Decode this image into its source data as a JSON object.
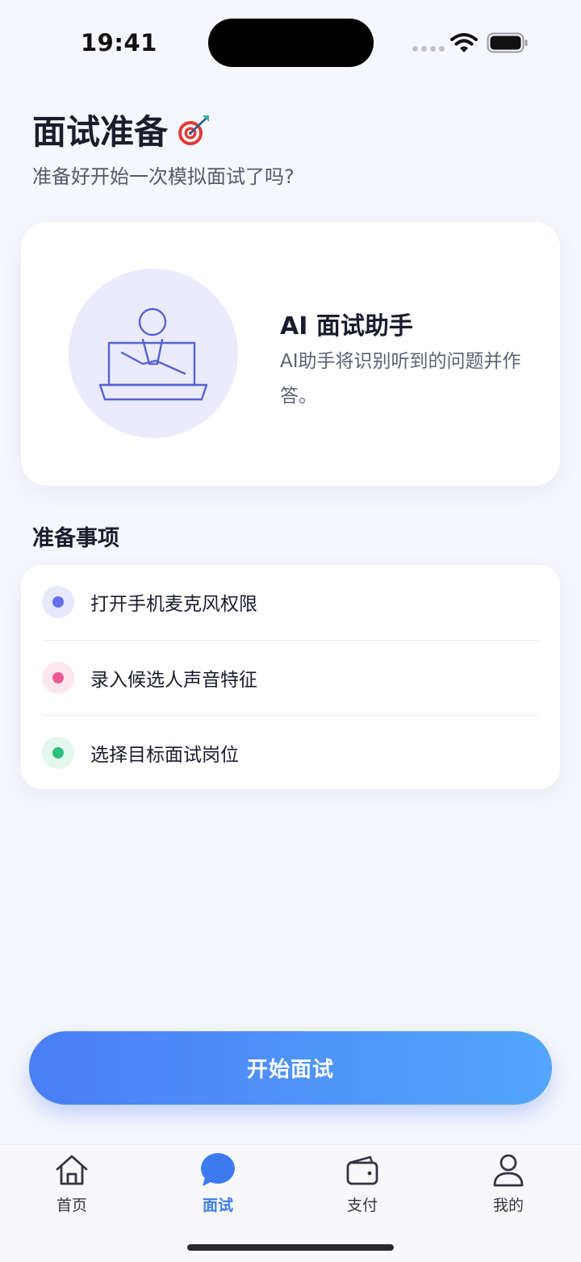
{
  "status_bar": {
    "time": "19:41"
  },
  "header": {
    "title": "面试准备",
    "subtitle": "准备好开始一次模拟面试了吗?"
  },
  "ai_card": {
    "title": "AI 面试助手",
    "description": "AI助手将识别听到的问题并作答。"
  },
  "checklist": {
    "title": "准备事项",
    "items": [
      {
        "label": "打开手机麦克风权限",
        "color": "#6670ec",
        "bg": "#e7e8fc"
      },
      {
        "label": "录入候选人声音特征",
        "color": "#ea5a92",
        "bg": "#fde7ef"
      },
      {
        "label": "选择目标面试岗位",
        "color": "#2fbf7f",
        "bg": "#e3f7ee"
      }
    ]
  },
  "start_button": {
    "label": "开始面试"
  },
  "tab_bar": {
    "items": [
      {
        "label": "首页",
        "icon": "home-icon"
      },
      {
        "label": "面试",
        "icon": "chat-bubble-icon",
        "active": true
      },
      {
        "label": "支付",
        "icon": "wallet-icon"
      },
      {
        "label": "我的",
        "icon": "user-icon"
      }
    ]
  },
  "colors": {
    "accent": "#3c7bef",
    "gradient_start": "#4a7ef6",
    "gradient_end": "#53a6fb",
    "illustration_stroke": "#5462d6"
  }
}
